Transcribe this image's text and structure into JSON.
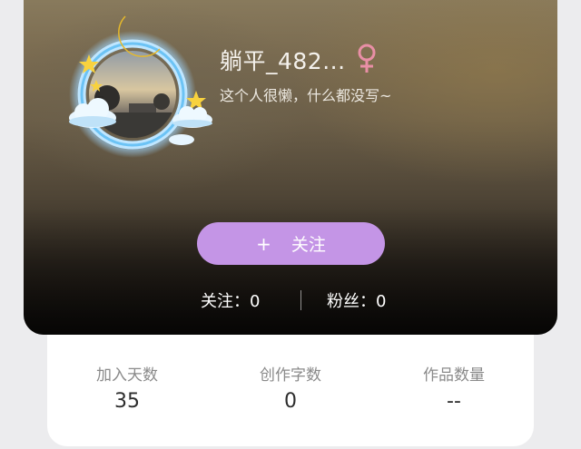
{
  "profile": {
    "username": "躺平_482...",
    "bio": "这个人很懒，什么都没写~",
    "gender_icon": "female-icon",
    "gender_color": "#e98fa6"
  },
  "actions": {
    "follow_plus": "+",
    "follow_label": "关注",
    "follow_color": "#c495e6"
  },
  "counts": {
    "following_label": "关注：",
    "following_value": "0",
    "fans_label": "粉丝：",
    "fans_value": "0"
  },
  "stats": [
    {
      "label": "加入天数",
      "value": "35"
    },
    {
      "label": "创作字数",
      "value": "0"
    },
    {
      "label": "作品数量",
      "value": "--"
    }
  ]
}
